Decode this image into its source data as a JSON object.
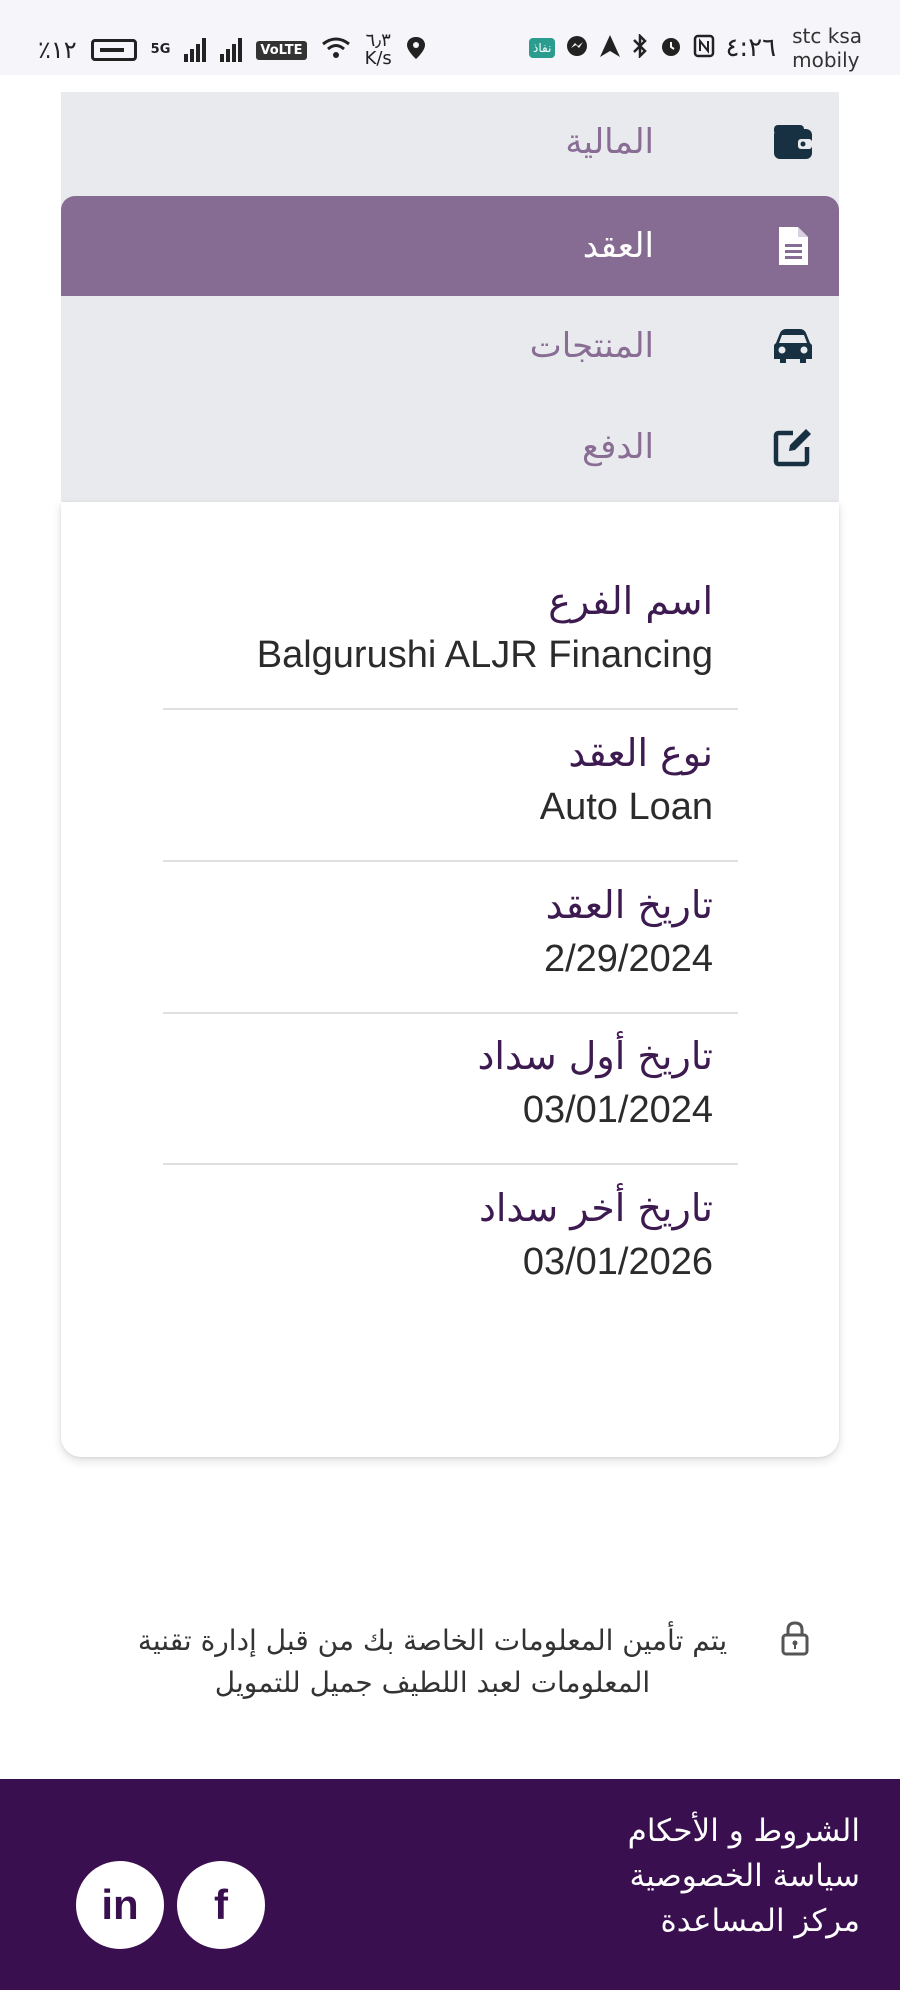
{
  "status_bar": {
    "battery": "٪١٢",
    "network_5g": "5G",
    "volte": "VoLTE",
    "speed_value": "٦٫٣",
    "speed_unit": "K/s",
    "nafath_badge": "نفاذ",
    "time": "٤:٢٦",
    "carrier_line1": "stc ksa",
    "carrier_line2": "mobily"
  },
  "menu": {
    "items": [
      {
        "label": "المالية",
        "icon": "wallet-icon"
      },
      {
        "label": "العقد",
        "icon": "document-icon",
        "active": true
      },
      {
        "label": "المنتجات",
        "icon": "car-icon"
      },
      {
        "label": "الدفع",
        "icon": "edit-icon"
      }
    ]
  },
  "contract": {
    "fields": [
      {
        "label": "اسم الفرع",
        "value": "Balgurushi ALJR Financing"
      },
      {
        "label": "نوع العقد",
        "value": "Auto Loan"
      },
      {
        "label": "تاريخ العقد",
        "value": "2/29/2024"
      },
      {
        "label": "تاريخ أول سداد",
        "value": "03/01/2024"
      },
      {
        "label": "تاريخ أخر سداد",
        "value": "03/01/2026"
      }
    ]
  },
  "security_note": "يتم تأمين المعلومات الخاصة بك من قبل إدارة تقنية المعلومات لعبد اللطيف جميل للتمويل",
  "footer": {
    "links": [
      "الشروط و الأحكام",
      "سياسة الخصوصية",
      "مركز المساعدة"
    ],
    "socials": {
      "linkedin": "in",
      "facebook": "f"
    }
  },
  "colors": {
    "menu_bg": "#e8eaed",
    "active_bg": "#866b93",
    "label_purple": "#3d1a4f",
    "footer_bg": "#3a0f4f"
  }
}
